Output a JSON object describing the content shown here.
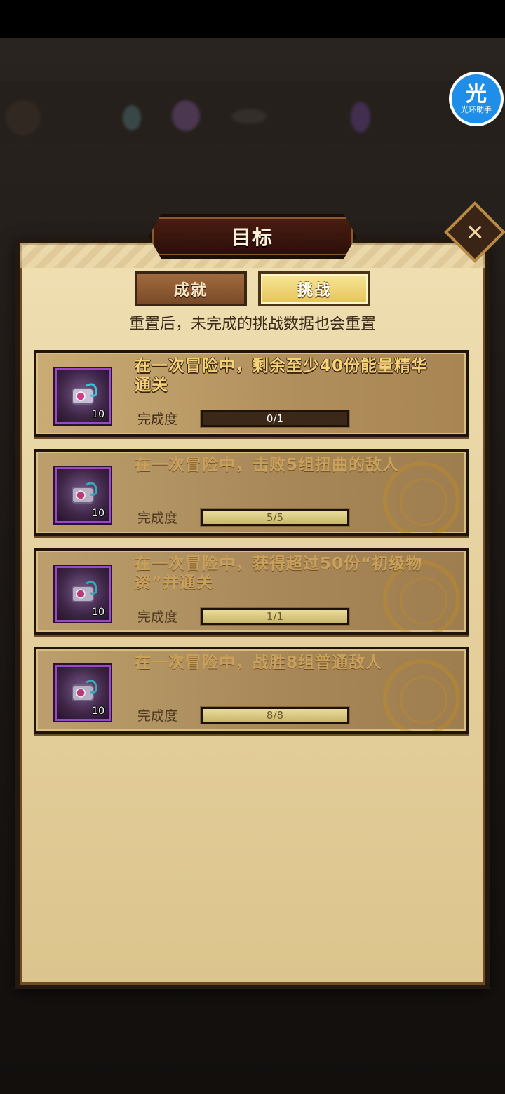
{
  "assistant": {
    "glyph": "光",
    "label": "光环助手"
  },
  "dialog": {
    "title": "目标",
    "close_glyph": "✕",
    "tabs": [
      {
        "label": "成就",
        "selected": false
      },
      {
        "label": "挑战",
        "selected": true
      }
    ],
    "notice": "重置后，未完成的挑战数据也会重置",
    "progress_label": "完成度",
    "challenges": [
      {
        "title": "在一次冒险中，剩余至少40份能量精华通关",
        "progress": "0/1",
        "fraction": 0,
        "reward_count": "10",
        "completed": false
      },
      {
        "title": "在一次冒险中，击败5组扭曲的敌人",
        "progress": "5/5",
        "fraction": 1,
        "reward_count": "10",
        "completed": true
      },
      {
        "title": "在一次冒险中，获得超过50份“初级物资”并通关",
        "progress": "1/1",
        "fraction": 1,
        "reward_count": "10",
        "completed": true
      },
      {
        "title": "在一次冒险中，战胜8组普通敌人",
        "progress": "8/8",
        "fraction": 1,
        "reward_count": "10",
        "completed": true
      }
    ]
  },
  "colors": {
    "title_active": "#f6d278",
    "title_done": "#c9a15a",
    "item_border": "#9b48c8",
    "tab_selected": "#e6c35a"
  }
}
